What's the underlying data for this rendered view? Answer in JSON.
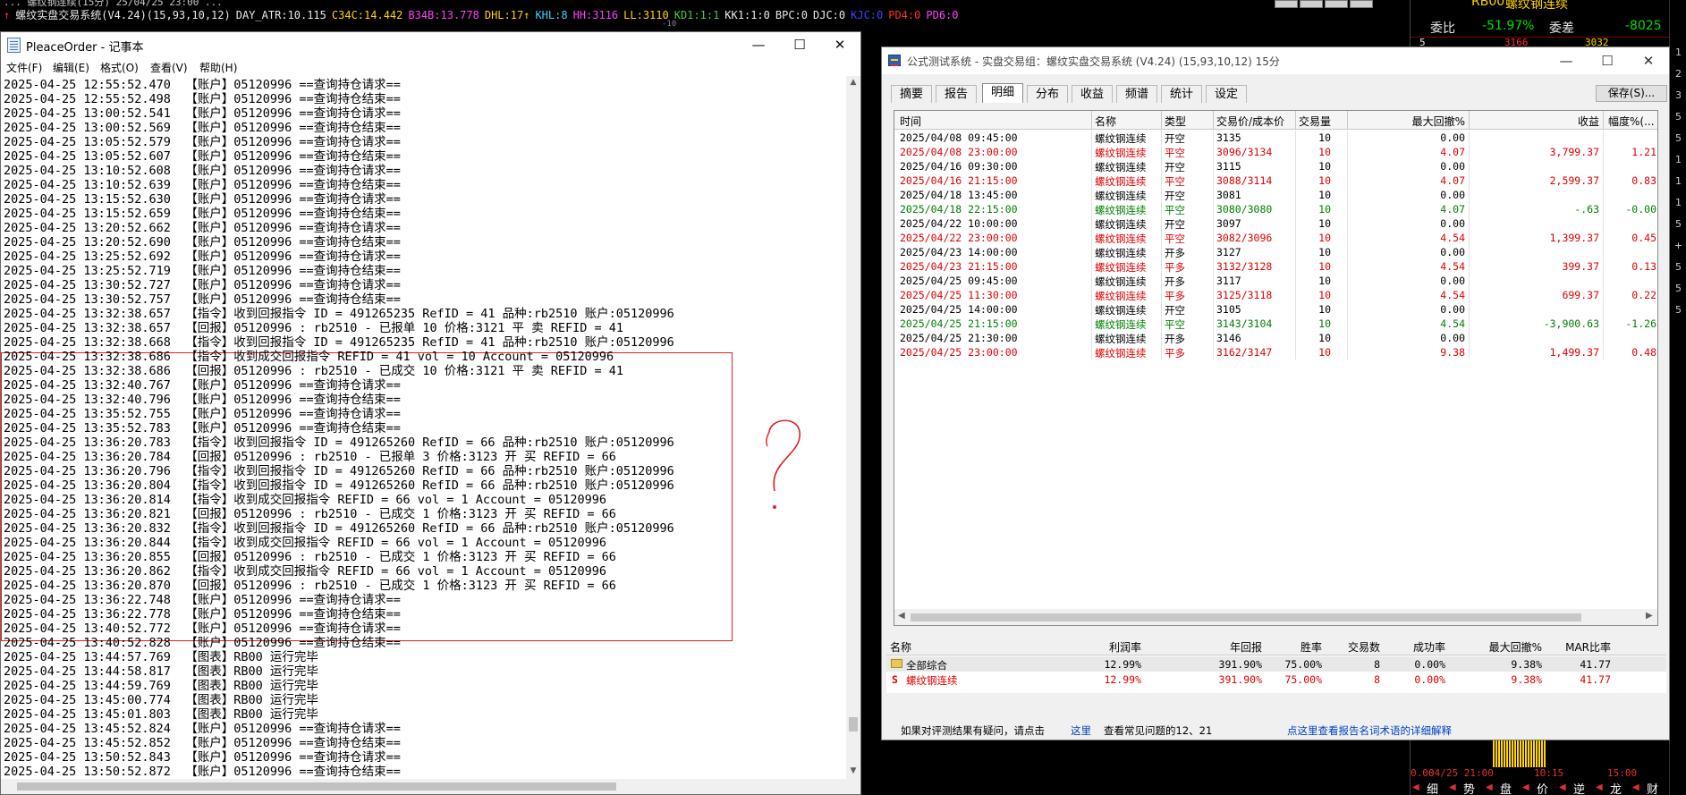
{
  "platform": {
    "topline": "... 螺纹钢连续(15分) 25/04/25 23:00 ...",
    "status_items": [
      {
        "text": "↑",
        "color": "#ff3030"
      },
      {
        "text": "螺纹实盘交易系统(V4.24)(15,93,10,12)",
        "color": "#e8e8e8"
      },
      {
        "text": "DAY_ATR:10.115",
        "color": "#e8e8e8"
      },
      {
        "text": "C34C:14.442",
        "color": "#ffd400"
      },
      {
        "text": "B34B:13.778",
        "color": "#ff40ff"
      },
      {
        "text": "DHL:17↑",
        "color": "#ffd400"
      },
      {
        "text": "KHL:8",
        "color": "#40d0ff"
      },
      {
        "text": "HH:3116",
        "color": "#ff40ff"
      },
      {
        "text": "LL:3110",
        "color": "#ffd400"
      },
      {
        "text": "KD1:1:1",
        "color": "#40d040"
      },
      {
        "text": "KK1:1:0",
        "color": "#e8e8e8"
      },
      {
        "text": "BPC:0",
        "color": "#e8e8e8"
      },
      {
        "text": "DJC:0",
        "color": "#e8e8e8"
      },
      {
        "text": "KJC:0",
        "color": "#4040ff"
      },
      {
        "text": "PD4:0",
        "color": "#ff3030"
      },
      {
        "text": "PD6:0",
        "color": "#ff40ff"
      }
    ],
    "tick_label": "-10",
    "right": {
      "symbol": "RB00",
      "name": "螺纹钢连续",
      "ratio_label": "委比",
      "ratio_value": "-51.97%",
      "diff_label": "委差",
      "diff_value": "-8025",
      "level_label": "5",
      "level_price": "3166",
      "level_volume": "3032",
      "axis_time_1": "04/25 21:00",
      "axis_time_2": "10:15",
      "axis_time_3": "15:00",
      "axis_value": "0.00",
      "bottom_tabs": [
        "细",
        "势",
        "盘",
        "价",
        "逆",
        "龙",
        "财"
      ]
    },
    "edge_labels": [
      "1",
      "2",
      "3",
      "5",
      "5",
      "1",
      "1",
      "1",
      "5",
      "+",
      "5",
      "5",
      "5"
    ]
  },
  "notepad": {
    "title": "PleaceOrder - 记事本",
    "menu": [
      "文件(F)",
      "编辑(E)",
      "格式(O)",
      "查看(V)",
      "帮助(H)"
    ],
    "lines": [
      "2025-04-25 12:55:52.470  【账户】05120996 ==查询持仓请求==",
      "2025-04-25 12:55:52.498  【账户】05120996 ==查询持仓结束==",
      "2025-04-25 13:00:52.541  【账户】05120996 ==查询持仓请求==",
      "2025-04-25 13:00:52.569  【账户】05120996 ==查询持仓结束==",
      "2025-04-25 13:05:52.579  【账户】05120996 ==查询持仓请求==",
      "2025-04-25 13:05:52.607  【账户】05120996 ==查询持仓结束==",
      "2025-04-25 13:10:52.608  【账户】05120996 ==查询持仓请求==",
      "2025-04-25 13:10:52.639  【账户】05120996 ==查询持仓结束==",
      "2025-04-25 13:15:52.630  【账户】05120996 ==查询持仓请求==",
      "2025-04-25 13:15:52.659  【账户】05120996 ==查询持仓结束==",
      "2025-04-25 13:20:52.662  【账户】05120996 ==查询持仓请求==",
      "2025-04-25 13:20:52.690  【账户】05120996 ==查询持仓结束==",
      "2025-04-25 13:25:52.692  【账户】05120996 ==查询持仓请求==",
      "2025-04-25 13:25:52.719  【账户】05120996 ==查询持仓结束==",
      "2025-04-25 13:30:52.727  【账户】05120996 ==查询持仓请求==",
      "2025-04-25 13:30:52.757  【账户】05120996 ==查询持仓结束==",
      "2025-04-25 13:32:38.657  【指令】收到回报指令 ID = 491265235 RefID = 41 品种:rb2510 账户:05120996",
      "2025-04-25 13:32:38.657  【回报】05120996 : rb2510 - 已报单 10 价格:3121 平 卖 REFID = 41",
      "2025-04-25 13:32:38.668  【指令】收到回报指令 ID = 491265235 RefID = 41 品种:rb2510 账户:05120996",
      "2025-04-25 13:32:38.686  【指令】收到成交回报指令 REFID = 41 vol = 10 Account = 05120996",
      "2025-04-25 13:32:38.686  【回报】05120996 : rb2510 - 已成交 10 价格:3121 平 卖 REFID = 41",
      "2025-04-25 13:32:40.767  【账户】05120996 ==查询持仓请求==",
      "2025-04-25 13:32:40.796  【账户】05120996 ==查询持仓结束==",
      "2025-04-25 13:35:52.755  【账户】05120996 ==查询持仓请求==",
      "2025-04-25 13:35:52.783  【账户】05120996 ==查询持仓结束==",
      "2025-04-25 13:36:20.783  【指令】收到回报指令 ID = 491265260 RefID = 66 品种:rb2510 账户:05120996",
      "2025-04-25 13:36:20.784  【回报】05120996 : rb2510 - 已报单 3 价格:3123 开 买 REFID = 66",
      "2025-04-25 13:36:20.796  【指令】收到回报指令 ID = 491265260 RefID = 66 品种:rb2510 账户:05120996",
      "2025-04-25 13:36:20.804  【指令】收到回报指令 ID = 491265260 RefID = 66 品种:rb2510 账户:05120996",
      "2025-04-25 13:36:20.814  【指令】收到成交回报指令 REFID = 66 vol = 1 Account = 05120996",
      "2025-04-25 13:36:20.821  【回报】05120996 : rb2510 - 已成交 1 价格:3123 开 买 REFID = 66",
      "2025-04-25 13:36:20.832  【指令】收到回报指令 ID = 491265260 RefID = 66 品种:rb2510 账户:05120996",
      "2025-04-25 13:36:20.844  【指令】收到成交回报指令 REFID = 66 vol = 1 Account = 05120996",
      "2025-04-25 13:36:20.855  【回报】05120996 : rb2510 - 已成交 1 价格:3123 开 买 REFID = 66",
      "2025-04-25 13:36:20.862  【指令】收到成交回报指令 REFID = 66 vol = 1 Account = 05120996",
      "2025-04-25 13:36:20.870  【回报】05120996 : rb2510 - 已成交 1 价格:3123 开 买 REFID = 66",
      "2025-04-25 13:36:22.748  【账户】05120996 ==查询持仓请求==",
      "2025-04-25 13:36:22.778  【账户】05120996 ==查询持仓结束==",
      "2025-04-25 13:40:52.772  【账户】05120996 ==查询持仓请求==",
      "2025-04-25 13:40:52.828  【账户】05120996 ==查询持仓结束==",
      "2025-04-25 13:44:57.769  【图表】RB00 运行完毕",
      "2025-04-25 13:44:58.817  【图表】RB00 运行完毕",
      "2025-04-25 13:44:59.769  【图表】RB00 运行完毕",
      "2025-04-25 13:45:00.774  【图表】RB00 运行完毕",
      "2025-04-25 13:45:01.803  【图表】RB00 运行完毕",
      "2025-04-25 13:45:52.824  【账户】05120996 ==查询持仓请求==",
      "2025-04-25 13:45:52.852  【账户】05120996 ==查询持仓结束==",
      "2025-04-25 13:50:52.843  【账户】05120996 ==查询持仓请求==",
      "2025-04-25 13:50:52.872  【账户】05120996 ==查询持仓结束=="
    ],
    "annotation_mark": "?"
  },
  "tester": {
    "title": "公式测试系统 - 实盘交易组：螺纹实盘交易系统 (V4.24) (15,93,10,12) 15分",
    "tabs": [
      "摘要",
      "报告",
      "明细",
      "分布",
      "收益",
      "频谱",
      "统计",
      "设定"
    ],
    "active_tab": "明细",
    "save_label": "保存(S)...",
    "columns": [
      "时间",
      "名称",
      "类型",
      "交易价/成本价",
      "交易量",
      "最大回撤%",
      "收益",
      "幅度%(..."
    ],
    "rows": [
      {
        "time": "2025/04/08 09:45:00",
        "name": "螺纹钢连续",
        "type": "开空",
        "price": "3135",
        "vol": "10",
        "dd": "0.00",
        "profit": "",
        "pct": "",
        "color": "#000000"
      },
      {
        "time": "2025/04/08 23:00:00",
        "name": "螺纹钢连续",
        "type": "平空",
        "price": "3096/3134",
        "vol": "10",
        "dd": "4.07",
        "profit": "3,799.37",
        "pct": "1.21",
        "color": "#e00000"
      },
      {
        "time": "2025/04/16 09:30:00",
        "name": "螺纹钢连续",
        "type": "开空",
        "price": "3115",
        "vol": "10",
        "dd": "0.00",
        "profit": "",
        "pct": "",
        "color": "#000000"
      },
      {
        "time": "2025/04/16 21:15:00",
        "name": "螺纹钢连续",
        "type": "平空",
        "price": "3088/3114",
        "vol": "10",
        "dd": "4.07",
        "profit": "2,599.37",
        "pct": "0.83",
        "color": "#e00000"
      },
      {
        "time": "2025/04/18 13:45:00",
        "name": "螺纹钢连续",
        "type": "开空",
        "price": "3081",
        "vol": "10",
        "dd": "0.00",
        "profit": "",
        "pct": "",
        "color": "#000000"
      },
      {
        "time": "2025/04/18 22:15:00",
        "name": "螺纹钢连续",
        "type": "平空",
        "price": "3080/3080",
        "vol": "10",
        "dd": "4.07",
        "profit": "-.63",
        "pct": "-0.00",
        "color": "#008000"
      },
      {
        "time": "2025/04/22 10:00:00",
        "name": "螺纹钢连续",
        "type": "开空",
        "price": "3097",
        "vol": "10",
        "dd": "0.00",
        "profit": "",
        "pct": "",
        "color": "#000000"
      },
      {
        "time": "2025/04/22 23:00:00",
        "name": "螺纹钢连续",
        "type": "平空",
        "price": "3082/3096",
        "vol": "10",
        "dd": "4.54",
        "profit": "1,399.37",
        "pct": "0.45",
        "color": "#e00000"
      },
      {
        "time": "2025/04/23 14:00:00",
        "name": "螺纹钢连续",
        "type": "开多",
        "price": "3127",
        "vol": "10",
        "dd": "0.00",
        "profit": "",
        "pct": "",
        "color": "#000000"
      },
      {
        "time": "2025/04/23 21:15:00",
        "name": "螺纹钢连续",
        "type": "平多",
        "price": "3132/3128",
        "vol": "10",
        "dd": "4.54",
        "profit": "399.37",
        "pct": "0.13",
        "color": "#e00000"
      },
      {
        "time": "2025/04/25 09:45:00",
        "name": "螺纹钢连续",
        "type": "开多",
        "price": "3117",
        "vol": "10",
        "dd": "0.00",
        "profit": "",
        "pct": "",
        "color": "#000000"
      },
      {
        "time": "2025/04/25 11:30:00",
        "name": "螺纹钢连续",
        "type": "平多",
        "price": "3125/3118",
        "vol": "10",
        "dd": "4.54",
        "profit": "699.37",
        "pct": "0.22",
        "color": "#e00000"
      },
      {
        "time": "2025/04/25 14:00:00",
        "name": "螺纹钢连续",
        "type": "开空",
        "price": "3105",
        "vol": "10",
        "dd": "0.00",
        "profit": "",
        "pct": "",
        "color": "#000000"
      },
      {
        "time": "2025/04/25 21:15:00",
        "name": "螺纹钢连续",
        "type": "平空",
        "price": "3143/3104",
        "vol": "10",
        "dd": "4.54",
        "profit": "-3,900.63",
        "pct": "-1.26",
        "color": "#008000"
      },
      {
        "time": "2025/04/25 21:30:00",
        "name": "螺纹钢连续",
        "type": "开多",
        "price": "3146",
        "vol": "10",
        "dd": "0.00",
        "profit": "",
        "pct": "",
        "color": "#000000"
      },
      {
        "time": "2025/04/25 23:00:00",
        "name": "螺纹钢连续",
        "type": "平多",
        "price": "3162/3147",
        "vol": "10",
        "dd": "9.38",
        "profit": "1,499.37",
        "pct": "0.48",
        "color": "#e00000"
      }
    ],
    "summary_columns": [
      "名称",
      "利润率",
      "年回报",
      "胜率",
      "交易数",
      "成功率",
      "最大回撤%",
      "MAR比率"
    ],
    "summary_rows": [
      {
        "icon": "folder",
        "name": "全部综合",
        "profit_rate": "12.99%",
        "annual": "391.90%",
        "win": "75.00%",
        "trades": "8",
        "success": "0.00%",
        "maxdd": "9.38%",
        "mar": "41.77",
        "color": "#000000"
      },
      {
        "icon": "S",
        "name": "螺纹钢连续",
        "profit_rate": "12.99%",
        "annual": "391.90%",
        "win": "75.00%",
        "trades": "8",
        "success": "0.00%",
        "maxdd": "9.38%",
        "mar": "41.77",
        "color": "#e00000"
      }
    ],
    "footer": {
      "question": "如果对评测结果有疑问，请点击",
      "link": "这里",
      "faq": "查看常见问题的12、21",
      "glossary": "点这里查看报告名词术语的详细解释"
    }
  }
}
